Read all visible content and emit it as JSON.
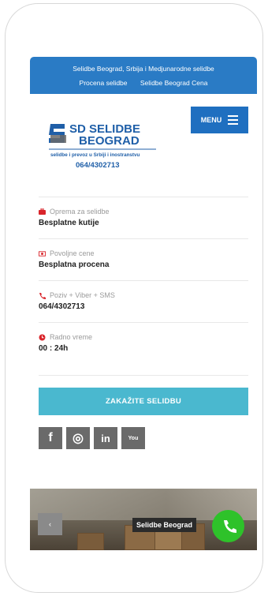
{
  "topbar": {
    "title": "Selidbe Beograd, Srbija i Medjunarodne selidbe",
    "links": [
      "Procena selidbe",
      "Selidbe Beograd Cena"
    ]
  },
  "logo": {
    "line1": "SD SELIDBE",
    "line2": "BEOGRAD",
    "tagline": "selidbe i prevoz u Srbiji i inostranstvu",
    "phone": "064/4302713"
  },
  "menu": {
    "label": "MENU",
    "icon": "hamburger-icon"
  },
  "info": [
    {
      "label": "Oprema za selidbe",
      "value": "Besplatne kutije",
      "icon": "briefcase-icon"
    },
    {
      "label": "Povoljne cene",
      "value": "Besplatna procena",
      "icon": "money-icon"
    },
    {
      "label": "Poziv + Viber + SMS",
      "value": "064/4302713",
      "icon": "phone-icon"
    },
    {
      "label": "Radno vreme",
      "value": "00 : 24h",
      "icon": "clock-icon"
    }
  ],
  "cta": {
    "label": "ZAKAŽITE SELIDBU"
  },
  "social": [
    {
      "label": "f",
      "icon": "facebook-icon"
    },
    {
      "label": "◎",
      "icon": "instagram-icon"
    },
    {
      "label": "in",
      "icon": "linkedin-icon"
    },
    {
      "label": "You",
      "icon": "youtube-icon"
    }
  ],
  "hero": {
    "caption": "Selidbe Beograd",
    "prev": "‹"
  },
  "colors": {
    "brand": "#2a7bc5",
    "menu": "#1f6fc0",
    "cta": "#4ab8cf",
    "accent": "#d9252b",
    "call": "#2ec22a"
  }
}
